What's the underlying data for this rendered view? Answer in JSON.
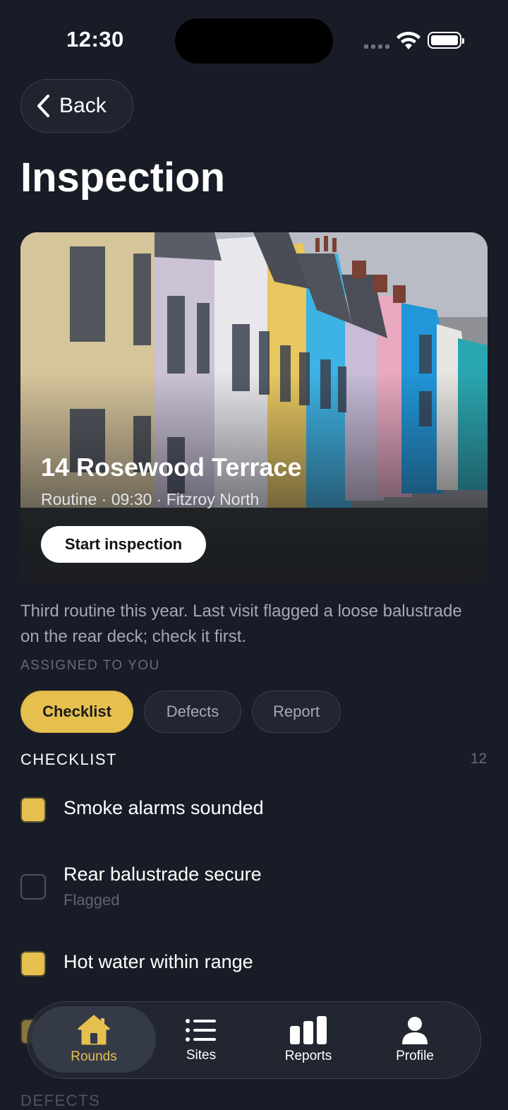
{
  "status_bar": {
    "time": "12:30"
  },
  "header": {
    "back_label": "Back",
    "title": "Inspection"
  },
  "hero": {
    "title": "14 Rosewood Terrace",
    "subtitle": "Routine · 09:30 · Fitzroy North",
    "cta_label": "Start inspection"
  },
  "note": "Third routine this year. Last visit flagged a loose balustrade on the rear deck; check it first.",
  "assigned_label": "ASSIGNED TO YOU",
  "tabs": [
    {
      "label": "Checklist",
      "active": true
    },
    {
      "label": "Defects",
      "active": false
    },
    {
      "label": "Report",
      "active": false
    }
  ],
  "checklist": {
    "heading": "CHECKLIST",
    "count": "12",
    "items": [
      {
        "label": "Smoke alarms sounded",
        "checked": true,
        "sub": ""
      },
      {
        "label": "Rear balustrade secure",
        "checked": false,
        "sub": "Flagged"
      },
      {
        "label": "Hot water within range",
        "checked": true,
        "sub": ""
      }
    ]
  },
  "defects_heading": "DEFECTS",
  "nav": [
    {
      "label": "Rounds",
      "icon": "home-icon",
      "active": true
    },
    {
      "label": "Sites",
      "icon": "list-icon",
      "active": false
    },
    {
      "label": "Reports",
      "icon": "bar-chart-icon",
      "active": false
    },
    {
      "label": "Profile",
      "icon": "person-icon",
      "active": false
    }
  ],
  "colors": {
    "accent": "#e6c04e",
    "background": "#181c26"
  }
}
